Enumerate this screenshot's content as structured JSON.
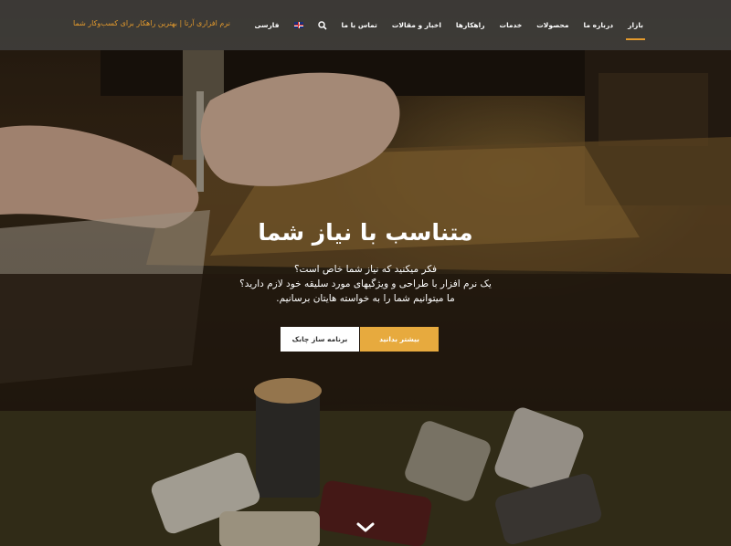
{
  "header": {
    "logo_text": "نرم افزاری آرتا | بهترین راهکار برای کسب‌وکار شما",
    "nav_items": [
      {
        "label": "بازار",
        "active": true
      },
      {
        "label": "درباره ما",
        "active": false
      },
      {
        "label": "محصولات",
        "active": false
      },
      {
        "label": "خدمات",
        "active": false
      },
      {
        "label": "راهکارها",
        "active": false
      },
      {
        "label": "اخبار و مقالات",
        "active": false
      },
      {
        "label": "تماس با ما",
        "active": false
      }
    ],
    "search_icon": "search-icon",
    "flag_icon": "uk-flag-icon",
    "language_label": "فارسی"
  },
  "hero": {
    "title": "متناسب با نیاز شما",
    "lines": [
      "فکر میکنید که نیاز شما خاص است؟",
      "یک نرم افزار با طراحی و ویژگیهای مورد سلیقه خود لازم دارید؟",
      "ما میتوانیم شما را به خواسته هایتان برسانیم."
    ],
    "button_secondary": "برنامه ساز چابک",
    "button_primary": "بیشتر بدانید",
    "scroll_icon": "chevron-down-icon"
  },
  "colors": {
    "accent": "#e7aa3e",
    "header_bg": "rgba(70,70,70,0.72)",
    "logo": "#e39a2d"
  }
}
